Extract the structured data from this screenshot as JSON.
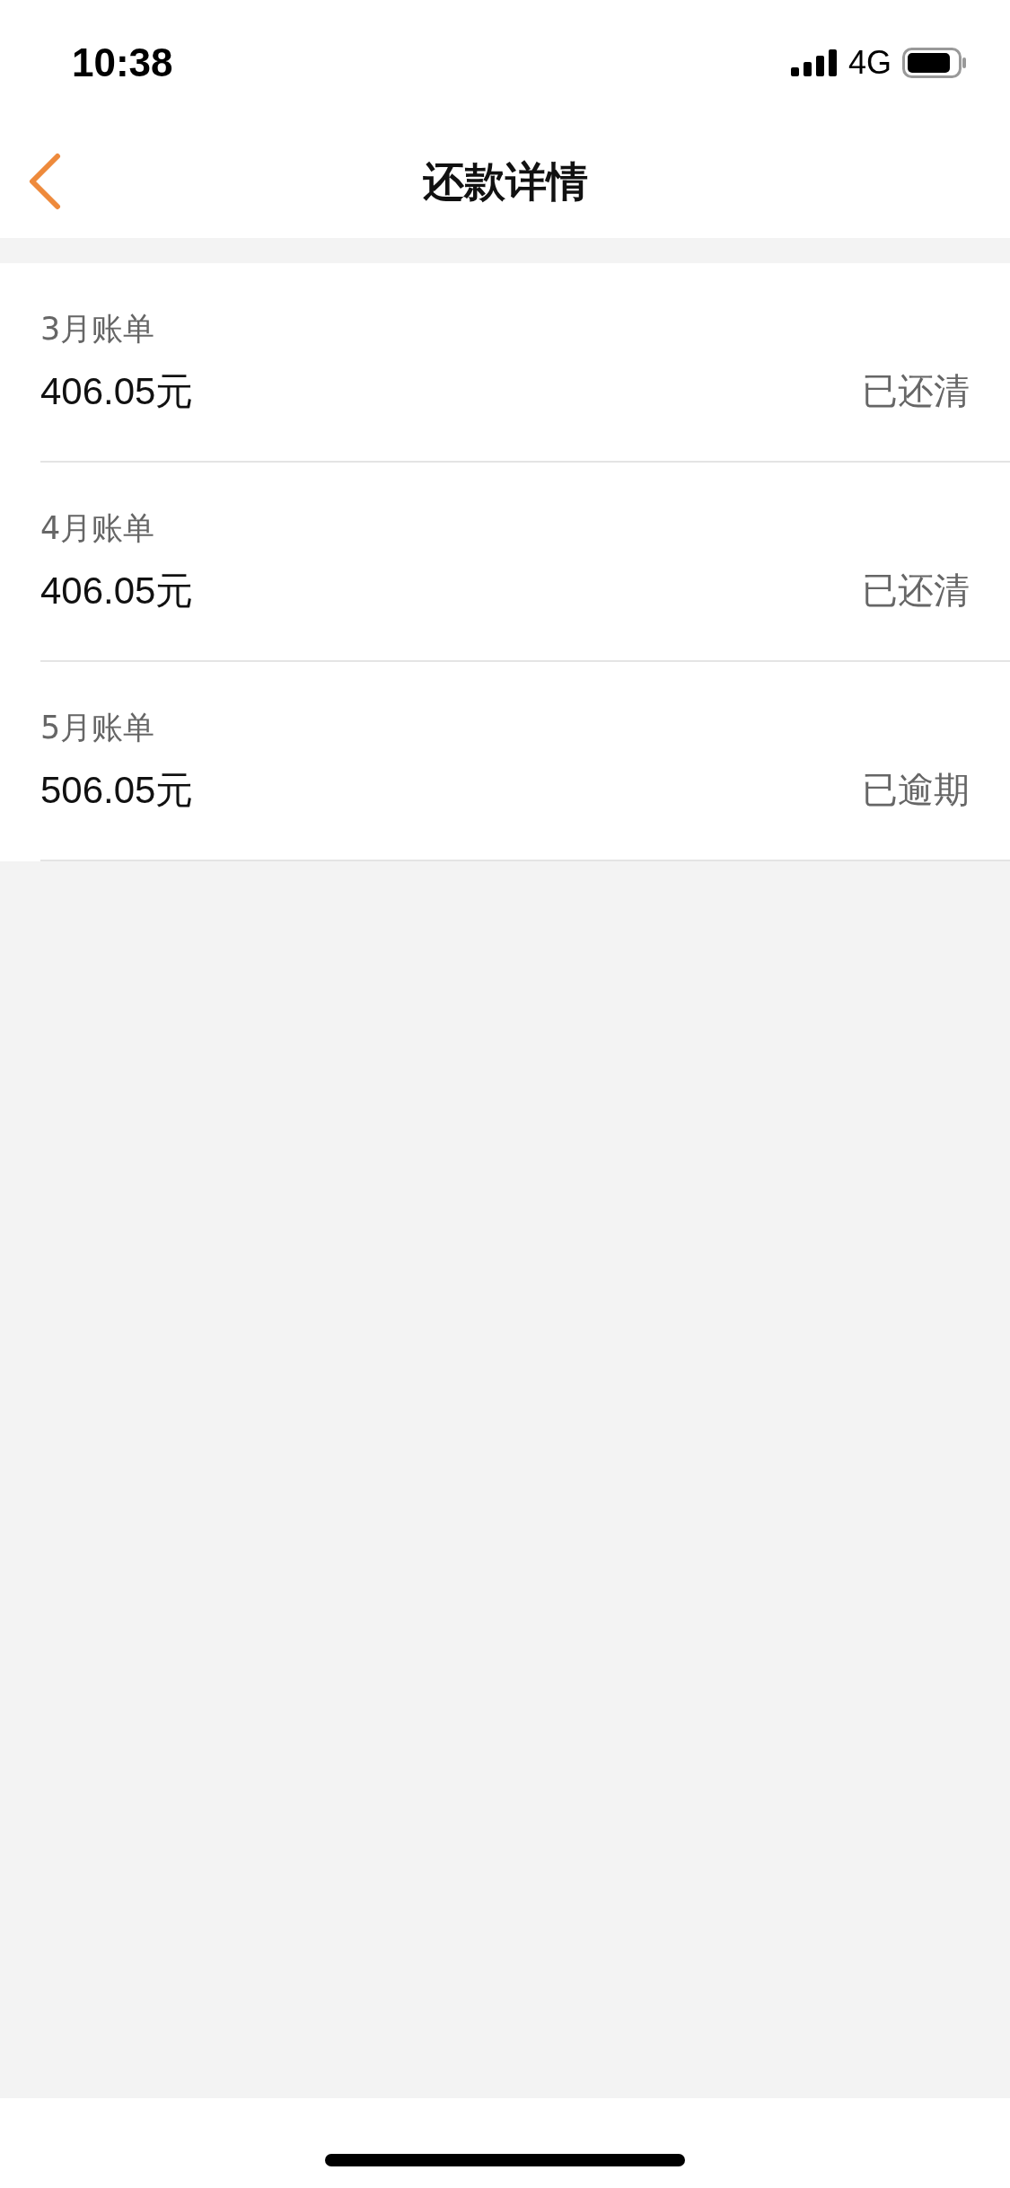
{
  "status_bar": {
    "time": "10:38",
    "network": "4G"
  },
  "nav_bar": {
    "title": "还款详情"
  },
  "bills": [
    {
      "label": "3月账单",
      "amount": "406.05元",
      "status": "已还清"
    },
    {
      "label": "4月账单",
      "amount": "406.05元",
      "status": "已还清"
    },
    {
      "label": "5月账单",
      "amount": "506.05元",
      "status": "已逾期"
    }
  ]
}
